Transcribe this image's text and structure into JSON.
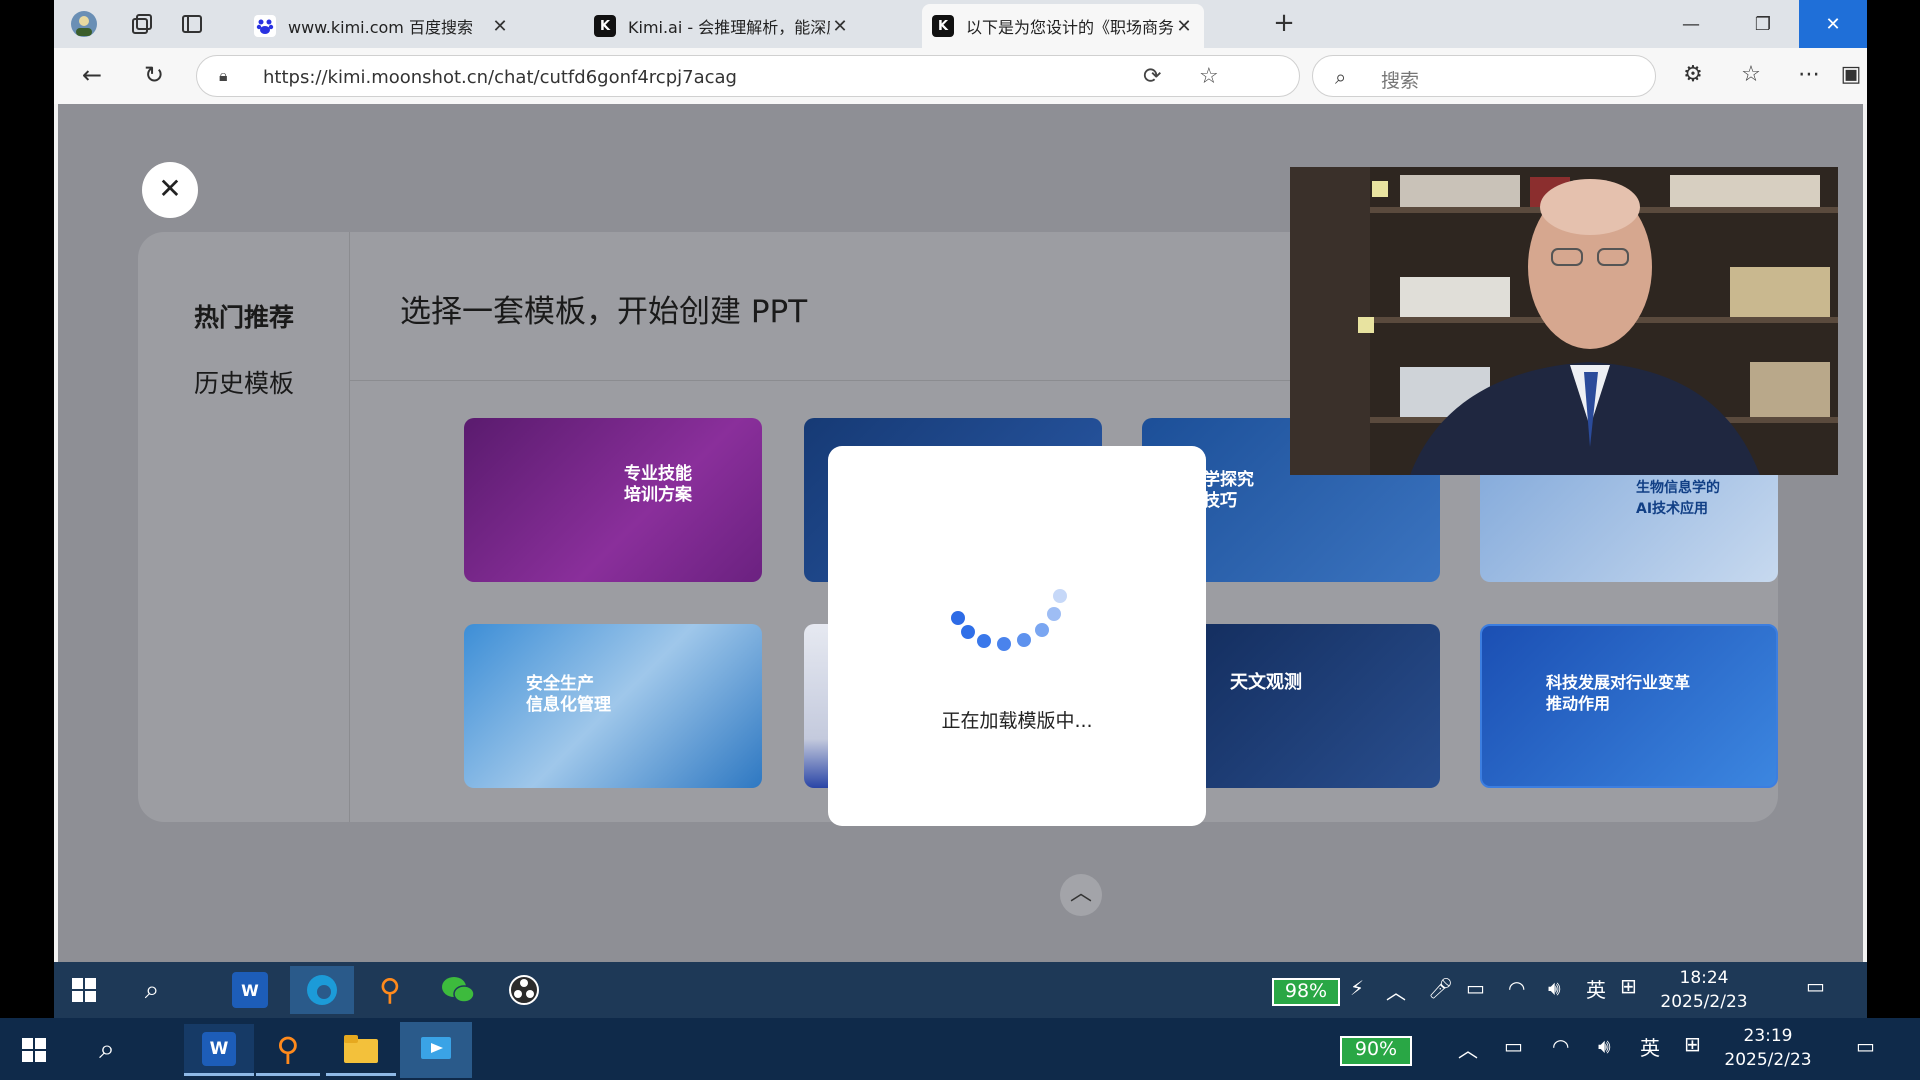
{
  "browser": {
    "tabs": [
      {
        "title": "www.kimi.com 百度搜索",
        "favicon": "baidu-icon",
        "active": false
      },
      {
        "title": "Kimi.ai - 会推理解析，能深度思考",
        "favicon": "K",
        "active": false
      },
      {
        "title": "以下是为您设计的《职场商务礼仪",
        "favicon": "K",
        "active": true
      }
    ],
    "url": "https://kimi.moonshot.cn/chat/cutfd6gonf4rcpj7acag",
    "search_placeholder": "搜索"
  },
  "page": {
    "sidebar": [
      "热门推荐",
      "历史模板"
    ],
    "panel_title": "选择一套模板，开始创建 PPT",
    "templates": [
      {
        "caption": "专业技能\n培训方案",
        "theme": "#7a2a8a"
      },
      {
        "caption": "",
        "theme": "#1f4c8f"
      },
      {
        "caption": "学生科学探究\n与实验技巧",
        "theme": "#2b5da8"
      },
      {
        "caption": "生物信息学的\nAI技术应用",
        "theme": "#2a62b0"
      },
      {
        "caption": "安全生产\n信息化管理",
        "theme": "#2f79c3"
      },
      {
        "caption": "",
        "theme": "#d7dbe6"
      },
      {
        "caption": "天文观测",
        "theme": "#1c3568"
      },
      {
        "caption": "科技发展对行业变革\n推动作用",
        "theme": "#2561c4"
      }
    ],
    "loading_text": "正在加载模版中..."
  },
  "taskbar_inner": {
    "battery": "98%",
    "ime": "英",
    "time": "18:24",
    "date": "2025/2/23"
  },
  "taskbar_outer": {
    "battery": "90%",
    "ime": "英",
    "time": "23:19",
    "date": "2025/2/23"
  }
}
